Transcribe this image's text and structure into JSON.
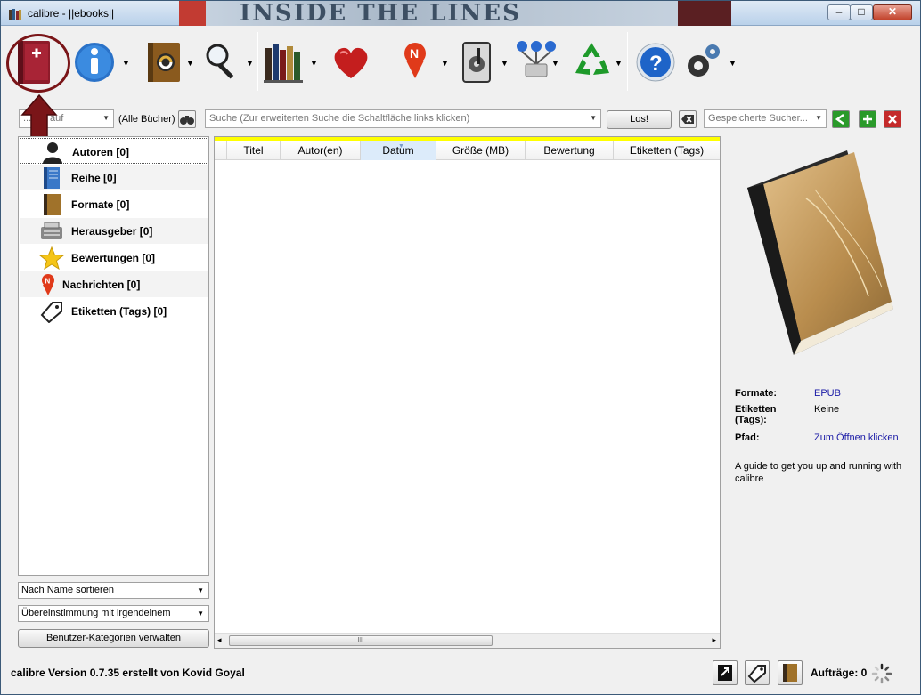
{
  "window": {
    "title": "calibre - ||ebooks||",
    "banner_text": "INSIDE THE LINES",
    "minimize_glyph": "–",
    "maximize_glyph": "□",
    "close_glyph": "✕"
  },
  "toolbar": {
    "icons": [
      "add-books-icon",
      "info-icon",
      "convert-icon",
      "search-icon",
      "library-icon",
      "donate-icon",
      "news-icon",
      "device-icon",
      "connect-icon",
      "recycle-icon",
      "help-icon",
      "preferences-icon"
    ],
    "dropdown_glyph": "▼"
  },
  "search": {
    "restrict_label": "...ken auf",
    "all_books_label": "(Alle Bücher)",
    "placeholder": "Suche (Zur erweiterten Suche die Schaltfläche links klicken)",
    "go_label": "Los!",
    "saved_search_placeholder": "Gespeicherte Sucher...",
    "dropdown_glyph": "▼"
  },
  "tag_browser": {
    "items": [
      {
        "label": "Autoren [0]",
        "icon": "author-icon"
      },
      {
        "label": "Reihe [0]",
        "icon": "series-icon"
      },
      {
        "label": "Formate [0]",
        "icon": "formats-icon"
      },
      {
        "label": "Herausgeber [0]",
        "icon": "publisher-icon"
      },
      {
        "label": "Bewertungen [0]",
        "icon": "rating-star-icon"
      },
      {
        "label": "Nachrichten [0]",
        "icon": "news-icon"
      },
      {
        "label": "Etiketten (Tags) [0]",
        "icon": "tag-icon"
      }
    ],
    "sort_by": "Nach Name sortieren",
    "match": "Übereinstimmung mit irgendeinem",
    "manage_label": "Benutzer-Kategorien verwalten"
  },
  "book_list": {
    "columns": [
      "Titel",
      "Autor(en)",
      "Datum",
      "Größe (MB)",
      "Bewertung",
      "Etiketten (Tags)"
    ],
    "sorted_column": "Datum",
    "scroll_grip": "III",
    "scroll_left": "◂",
    "scroll_right": "▸"
  },
  "details": {
    "formats_key": "Formate:",
    "formats_value": "EPUB",
    "tags_key": "Etiketten (Tags):",
    "tags_value": "Keine",
    "path_key": "Pfad:",
    "path_value": "Zum Öffnen klicken",
    "comment": "A guide to get you up and running with calibre"
  },
  "status": {
    "version_text": "calibre Version 0.7.35 erstellt von Kovid Goyal",
    "jobs_label": "Aufträge: 0"
  },
  "colors": {
    "highlight": "#7a1518",
    "selection_bar": "#ffff00",
    "link": "#1a1aa6"
  }
}
